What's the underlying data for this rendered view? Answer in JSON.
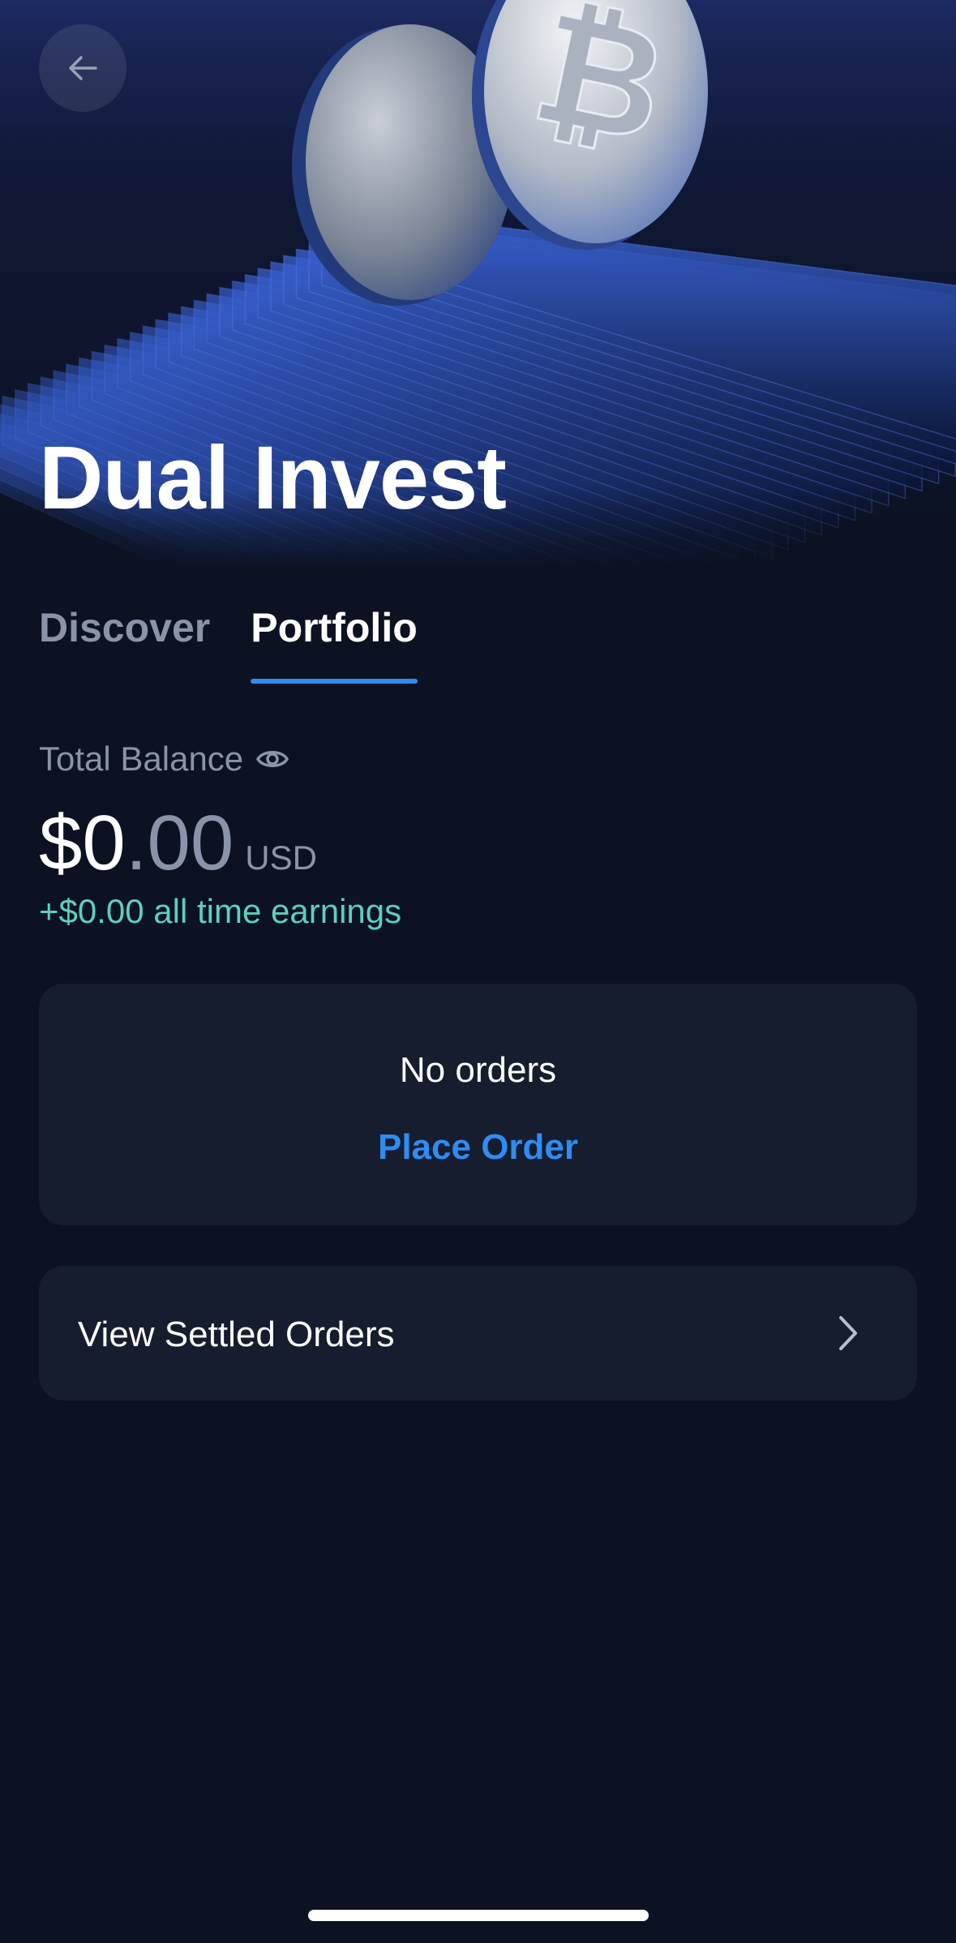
{
  "header": {
    "title": "Dual Invest",
    "back_icon": "arrow-left-icon"
  },
  "tabs": [
    {
      "label": "Discover",
      "active": false
    },
    {
      "label": "Portfolio",
      "active": true
    }
  ],
  "balance": {
    "label": "Total Balance",
    "visibility_icon": "eye-icon",
    "amount_main": "$0",
    "amount_decimal": ".00",
    "currency": "USD",
    "earnings": "+$0.00 all time earnings"
  },
  "orders_card": {
    "empty_text": "No orders",
    "action_label": "Place Order"
  },
  "settled_card": {
    "label": "View Settled Orders",
    "chevron_icon": "chevron-right-icon"
  },
  "colors": {
    "background": "#0c1222",
    "card": "#161d2e",
    "accent": "#2f8cf4",
    "muted": "#8a93a8",
    "positive": "#5dd0bb"
  }
}
